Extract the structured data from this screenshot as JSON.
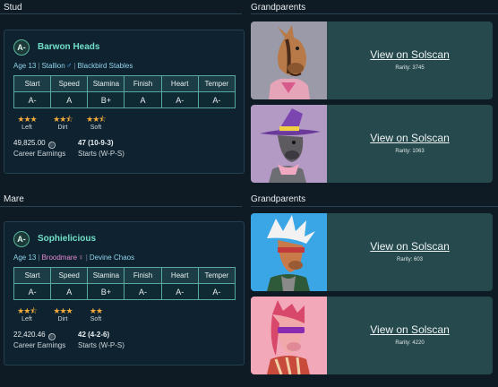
{
  "stud": {
    "section_label": "Stud",
    "grandparents_label": "Grandparents",
    "horse": {
      "grade": "A-",
      "name": "Barwon Heads",
      "age": "Age 13",
      "gender": "Stallion",
      "gender_icon": "♂",
      "stable": "Blackbird Stables",
      "stat_headers": [
        "Start",
        "Speed",
        "Stamina",
        "Finish",
        "Heart",
        "Temper"
      ],
      "stat_values": [
        "A-",
        "A",
        "B+",
        "A",
        "A-",
        "A-"
      ],
      "preferences": [
        {
          "stars": "★★★",
          "label": "Left"
        },
        {
          "stars": "★★⯪",
          "label": "Dirt"
        },
        {
          "stars": "★★⯪",
          "label": "Soft"
        }
      ],
      "earnings": "49,825.00",
      "earnings_label": "Career Earnings",
      "starts": "47 (10-9-3)",
      "starts_label": "Starts (W-P-S)"
    },
    "grandparents": [
      {
        "link": "View on Solscan",
        "rarity": "Rarity: 3745"
      },
      {
        "link": "View on Solscan",
        "rarity": "Rarity: 1063"
      }
    ]
  },
  "mare": {
    "section_label": "Mare",
    "grandparents_label": "Grandparents",
    "horse": {
      "grade": "A-",
      "name": "Sophielicious",
      "age": "Age 13",
      "gender": "Broodmare",
      "gender_icon": "♀",
      "stable": "Devine Chaos",
      "stat_headers": [
        "Start",
        "Speed",
        "Stamina",
        "Finish",
        "Heart",
        "Temper"
      ],
      "stat_values": [
        "A-",
        "A",
        "B+",
        "A-",
        "A-",
        "A-"
      ],
      "preferences": [
        {
          "stars": "★★⯪",
          "label": "Left"
        },
        {
          "stars": "★★★",
          "label": "Dirt"
        },
        {
          "stars": "★★",
          "label": "Soft"
        }
      ],
      "earnings": "22,420.46",
      "earnings_label": "Career Earnings",
      "starts": "42 (4-2-6)",
      "starts_label": "Starts (W-P-S)"
    },
    "grandparents": [
      {
        "link": "View on Solscan",
        "rarity": "Rarity: 603"
      },
      {
        "link": "View on Solscan",
        "rarity": "Rarity: 4220"
      }
    ]
  },
  "colors": {
    "accent": "#72e0c8",
    "star": "#f0a93a",
    "stallion": "#4fa3e6",
    "broodmare": "#e68ad0",
    "card_bg": "#25494d"
  }
}
